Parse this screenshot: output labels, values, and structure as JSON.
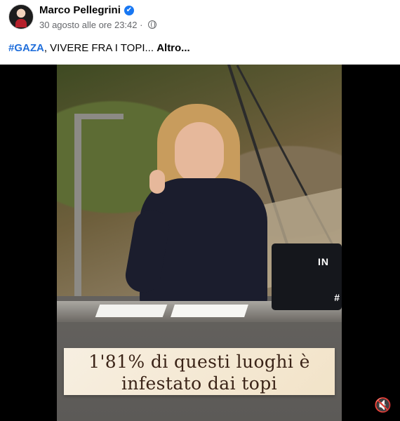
{
  "post": {
    "author": "Marco Pellegrini",
    "verified": "✔",
    "timestamp": "30 agosto alle ore 23:42",
    "separator": "·",
    "hashtag": "#GAZA",
    "text": ", VIVERE FRA I TOPI...",
    "more_label": "Altro..."
  },
  "video": {
    "caption_line_1": "1'81% di questi luoghi è",
    "caption_line_2": "infestato dai topi",
    "laptop_brand": "IN",
    "hash_mark": "#",
    "mute_icon": "🔇"
  },
  "colors": {
    "verified_badge": "#1877f2",
    "hashtag": "#216fdb",
    "meta_text": "#65676b",
    "caption_background": "#f7efe1"
  },
  "icons": {
    "verified": "verified-badge-icon",
    "audience": "globe-icon",
    "sound": "mute-icon"
  }
}
